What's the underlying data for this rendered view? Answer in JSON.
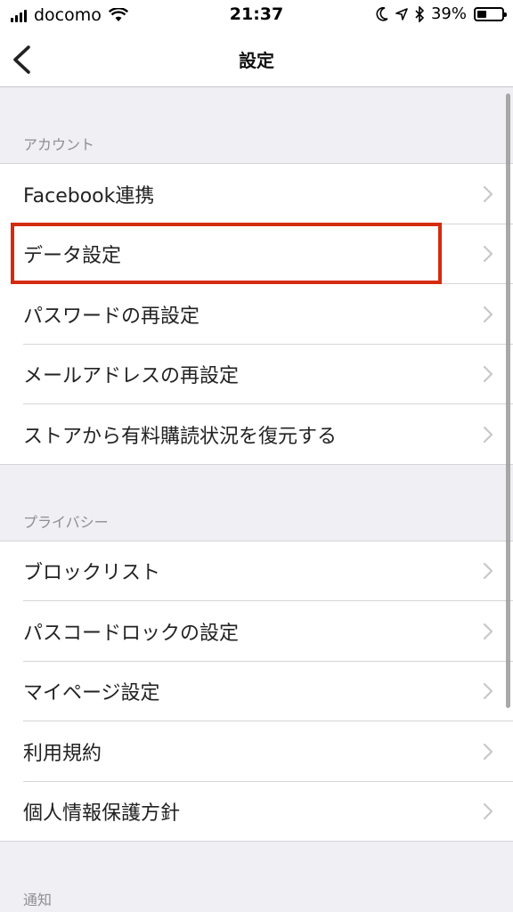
{
  "status_bar": {
    "carrier": "docomo",
    "time": "21:37",
    "battery_percent_text": "39%",
    "battery_level": 0.39,
    "icons": [
      "signal-icon",
      "wifi-icon",
      "moon-icon",
      "location-icon",
      "bluetooth-icon",
      "battery-icon"
    ]
  },
  "nav": {
    "title": "設定",
    "back_icon": "chevron-left-icon"
  },
  "sections": {
    "account": {
      "header": "アカウント",
      "items": [
        "Facebook連携",
        "データ設定",
        "パスワードの再設定",
        "メールアドレスの再設定",
        "ストアから有料購読状況を復元する"
      ]
    },
    "privacy": {
      "header": "プライバシー",
      "items": [
        "ブロックリスト",
        "パスコードロックの設定",
        "マイページ設定",
        "利用規約",
        "個人情報保護方針"
      ]
    },
    "notification": {
      "header": "通知"
    }
  },
  "colors": {
    "highlight": "#d42b0f",
    "background": "#efeff4",
    "chevron": "#c7c7cc"
  },
  "highlighted_item": "データ設定"
}
